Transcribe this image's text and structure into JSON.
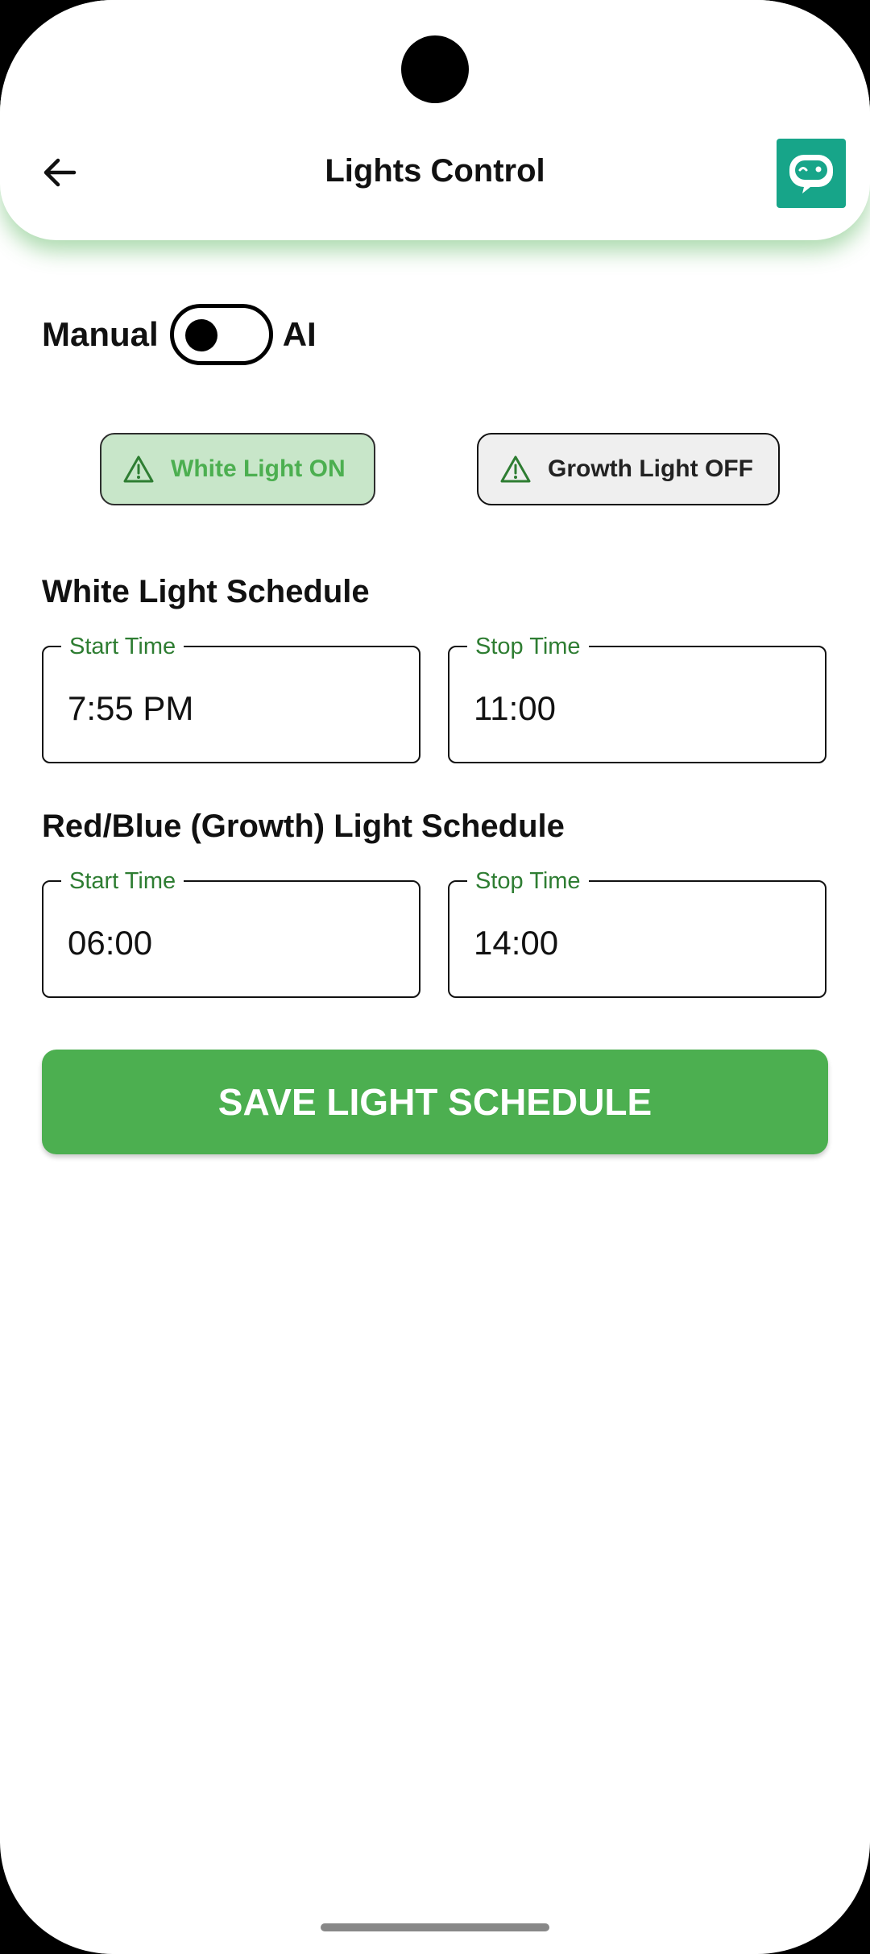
{
  "header": {
    "title": "Lights Control",
    "back_icon": "arrow-left-icon",
    "assistant_icon": "robot-icon",
    "assistant_color": "#17a589"
  },
  "mode": {
    "left_label": "Manual",
    "right_label": "AI",
    "selected": "Manual"
  },
  "status": {
    "white": {
      "label": "White Light ON",
      "icon": "warning-icon"
    },
    "growth": {
      "label": "Growth Light OFF",
      "icon": "warning-icon"
    }
  },
  "white_schedule": {
    "title": "White Light Schedule",
    "start": {
      "label": "Start Time",
      "value": "7:55 PM"
    },
    "stop": {
      "label": "Stop Time",
      "value": "11:00"
    }
  },
  "growth_schedule": {
    "title": "Red/Blue (Growth) Light Schedule",
    "start": {
      "label": "Start Time",
      "value": "06:00"
    },
    "stop": {
      "label": "Stop Time",
      "value": "14:00"
    }
  },
  "save_button": {
    "label": "SAVE LIGHT SCHEDULE"
  },
  "colors": {
    "accent": "#4caf50",
    "label_green": "#2e7d32",
    "status_on_bg": "#c8e6c9"
  }
}
